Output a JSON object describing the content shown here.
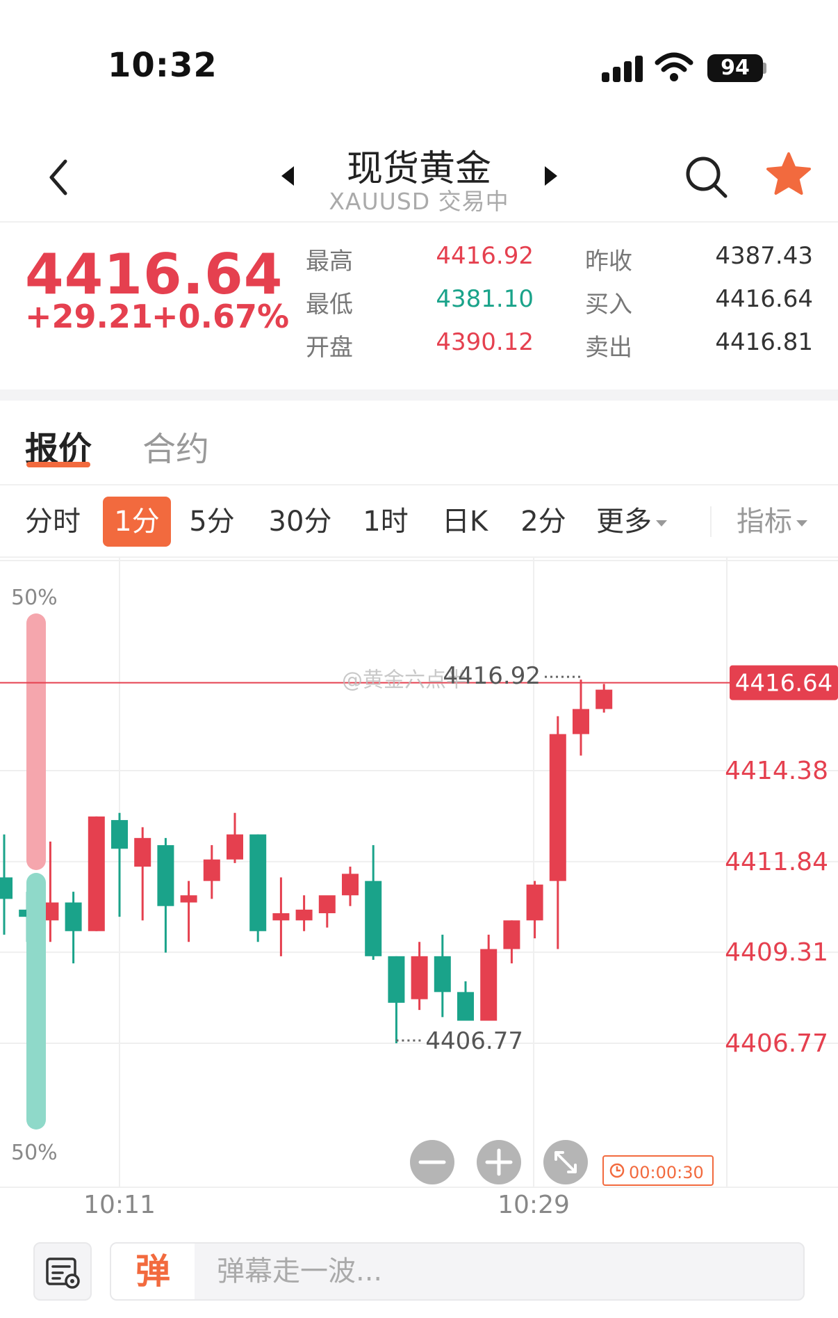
{
  "status": {
    "time": "10:32",
    "battery": "94"
  },
  "nav": {
    "title": "现货黄金",
    "subtitle": "XAUUSD 交易中"
  },
  "quote": {
    "last": "4416.64",
    "change": "+29.21",
    "change_pct": "+0.67%",
    "fields": [
      {
        "label": "最高",
        "value": "4416.92"
      },
      {
        "label": "最低",
        "value": "4381.10"
      },
      {
        "label": "开盘",
        "value": "4390.12"
      },
      {
        "label": "昨收",
        "value": "4387.43"
      },
      {
        "label": "买入",
        "value": "4416.64"
      },
      {
        "label": "卖出",
        "value": "4416.81"
      }
    ]
  },
  "tabs": [
    "报价",
    "合约"
  ],
  "periods": [
    "分时",
    "1分",
    "5分",
    "30分",
    "1时",
    "日K",
    "2分",
    "更多",
    "指标"
  ],
  "active_period": "1分",
  "colors": {
    "up": "#e5404f",
    "down": "#1aa38a",
    "accent": "#f26a3e"
  },
  "chart_data": {
    "type": "candlestick",
    "y_ticks": [
      "4414.38",
      "4411.84",
      "4409.31",
      "4406.77"
    ],
    "x_ticks": [
      "10:11",
      "10:29"
    ],
    "current_price_label": "4416.64",
    "high_marker": "4416.92",
    "low_marker": "4406.77",
    "watermark": "@黄金六点半",
    "sentiment": {
      "top": "50%",
      "bottom": "50%",
      "bull_fraction": 0.5
    },
    "timer": "00:00:30",
    "candles": [
      {
        "o": 4411.4,
        "h": 4412.6,
        "l": 4409.8,
        "c": 4410.8
      },
      {
        "o": 4410.5,
        "h": 4411.0,
        "l": 4409.6,
        "c": 4410.3
      },
      {
        "o": 4410.2,
        "h": 4412.4,
        "l": 4409.6,
        "c": 4410.7
      },
      {
        "o": 4410.7,
        "h": 4411.0,
        "l": 4409.0,
        "c": 4409.9
      },
      {
        "o": 4409.9,
        "h": 4413.1,
        "l": 4409.9,
        "c": 4413.1
      },
      {
        "o": 4413.0,
        "h": 4413.2,
        "l": 4410.3,
        "c": 4412.2
      },
      {
        "o": 4411.7,
        "h": 4412.8,
        "l": 4410.2,
        "c": 4412.5
      },
      {
        "o": 4412.3,
        "h": 4412.5,
        "l": 4409.3,
        "c": 4410.6
      },
      {
        "o": 4410.7,
        "h": 4411.3,
        "l": 4409.6,
        "c": 4410.9
      },
      {
        "o": 4411.3,
        "h": 4412.3,
        "l": 4410.8,
        "c": 4411.9
      },
      {
        "o": 4411.9,
        "h": 4413.2,
        "l": 4411.8,
        "c": 4412.6
      },
      {
        "o": 4412.6,
        "h": 4412.6,
        "l": 4409.6,
        "c": 4409.9
      },
      {
        "o": 4410.2,
        "h": 4411.4,
        "l": 4409.2,
        "c": 4410.4
      },
      {
        "o": 4410.2,
        "h": 4410.9,
        "l": 4409.9,
        "c": 4410.5
      },
      {
        "o": 4410.4,
        "h": 4410.8,
        "l": 4410.0,
        "c": 4410.9
      },
      {
        "o": 4410.9,
        "h": 4411.7,
        "l": 4410.6,
        "c": 4411.5
      },
      {
        "o": 4411.3,
        "h": 4412.3,
        "l": 4409.1,
        "c": 4409.2
      },
      {
        "o": 4409.2,
        "h": 4409.2,
        "l": 4406.77,
        "c": 4407.9
      },
      {
        "o": 4408.0,
        "h": 4409.6,
        "l": 4407.7,
        "c": 4409.2
      },
      {
        "o": 4409.2,
        "h": 4409.8,
        "l": 4407.5,
        "c": 4408.2
      },
      {
        "o": 4408.2,
        "h": 4408.5,
        "l": 4407.5,
        "c": 4407.4
      },
      {
        "o": 4407.4,
        "h": 4409.8,
        "l": 4407.4,
        "c": 4409.4
      },
      {
        "o": 4409.4,
        "h": 4410.2,
        "l": 4409.0,
        "c": 4410.2
      },
      {
        "o": 4410.2,
        "h": 4411.3,
        "l": 4409.7,
        "c": 4411.2
      },
      {
        "o": 4411.3,
        "h": 4415.9,
        "l": 4409.4,
        "c": 4415.4
      },
      {
        "o": 4415.4,
        "h": 4416.92,
        "l": 4414.8,
        "c": 4416.1
      },
      {
        "o": 4416.1,
        "h": 4416.8,
        "l": 4416.0,
        "c": 4416.64
      }
    ]
  }
}
